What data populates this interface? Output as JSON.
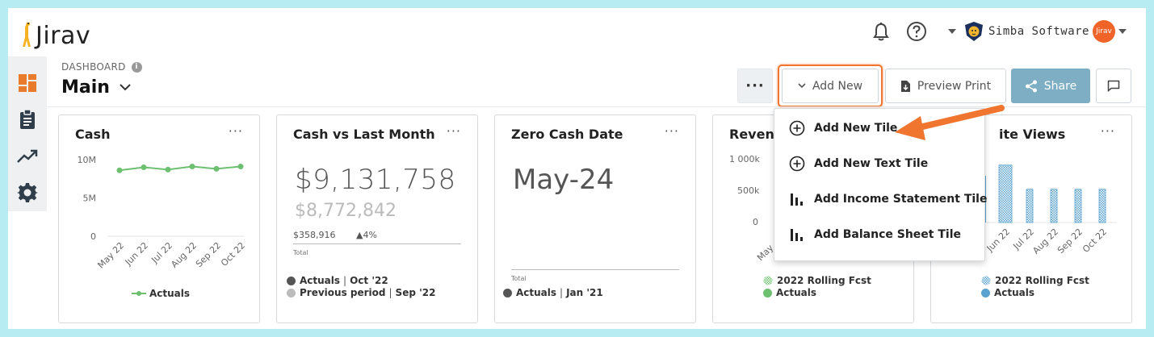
{
  "app": {
    "name": "Jirav"
  },
  "header": {
    "company_name": "Simba Software",
    "avatar_text": "Jirav"
  },
  "page": {
    "breadcrumb": "DASHBOARD",
    "title": "Main"
  },
  "toolbar": {
    "more_label": "···",
    "add_new_label": "Add New",
    "preview_label": "Preview Print",
    "share_label": "Share"
  },
  "dropdown": {
    "items": [
      {
        "label": "Add New Tile",
        "icon": "plus-circle-icon"
      },
      {
        "label": "Add New Text Tile",
        "icon": "plus-circle-icon"
      },
      {
        "label": "Add Income Statement Tile",
        "icon": "bar-chart-icon"
      },
      {
        "label": "Add Balance Sheet Tile",
        "icon": "bar-chart-icon"
      }
    ]
  },
  "cards": {
    "cash": {
      "title": "Cash",
      "menu": "···",
      "chart_data": {
        "type": "line",
        "categories": [
          "May 22",
          "Jun 22",
          "Jul 22",
          "Aug 22",
          "Sep 22",
          "Oct 22"
        ],
        "series": [
          {
            "name": "Actuals",
            "values": [
              8.6,
              9.0,
              8.7,
              9.1,
              8.8,
              9.1
            ],
            "color": "#6cc070"
          }
        ],
        "y_ticks": [
          "10M",
          "5M",
          "0"
        ],
        "ylim": [
          0,
          10
        ]
      }
    },
    "cash_vs": {
      "title": "Cash vs Last Month",
      "menu": "···",
      "value_main": "$9,131,758",
      "value_prev": "$8,772,842",
      "delta_abs": "$358,916",
      "delta_pct": "▲4%",
      "total_label": "Total",
      "legend": [
        {
          "name": "Actuals",
          "period": "Oct '22",
          "color": "#555555"
        },
        {
          "name": "Previous period",
          "period": "Sep '22",
          "color": "#bbbbbb"
        }
      ]
    },
    "zero_cash": {
      "title": "Zero Cash Date",
      "menu": "···",
      "value": "May-24",
      "total_label": "Total",
      "legend": [
        {
          "name": "Actuals",
          "period": "Jan '21",
          "color": "#555555"
        }
      ]
    },
    "revenue": {
      "title": "Revenu",
      "menu": "···",
      "chart_data": {
        "type": "bar",
        "y_ticks": [
          "1 000k",
          "500k",
          "0"
        ],
        "visible_x_ticks": [
          "May"
        ]
      },
      "legend": [
        {
          "name": "2022 Rolling Fcst",
          "color": "#6cc070",
          "pattern": "hatched"
        },
        {
          "name": "Actuals",
          "color": "#6cc070"
        }
      ]
    },
    "site_views": {
      "title": "ite Views",
      "menu": "···",
      "chart_data": {
        "type": "bar",
        "categories": [
          "Jun 22",
          "Jul 22",
          "Aug 22",
          "Sep 22",
          "Oct 22"
        ],
        "series": [
          {
            "name": "2022 Rolling Fcst",
            "values": [
              95,
              55,
              55,
              55,
              55
            ],
            "color": "#5aa3cf"
          }
        ],
        "ylim": [
          0,
          100
        ]
      },
      "legend": [
        {
          "name": "2022 Rolling Fcst",
          "color": "#5aa3cf",
          "pattern": "hatched"
        },
        {
          "name": "Actuals",
          "color": "#5aa3cf"
        }
      ]
    }
  }
}
